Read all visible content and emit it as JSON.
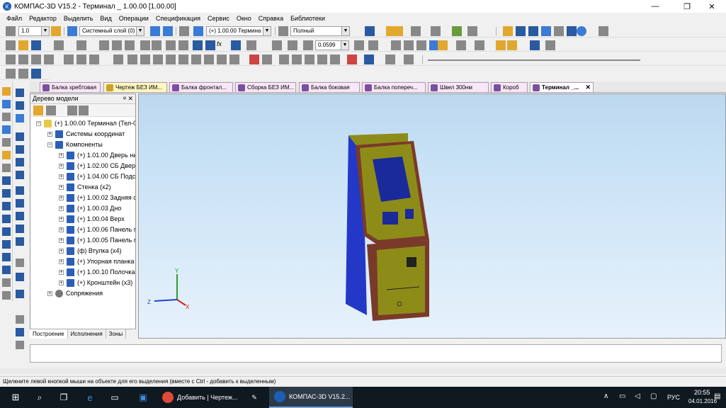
{
  "window": {
    "title": "КОМПАС-3D V15.2 - Терминал _ 1.00.00 [1.00.00]",
    "minimize": "—",
    "maximize": "❐",
    "close": "✕"
  },
  "menu": [
    "Файл",
    "Редактор",
    "Выделить",
    "Вид",
    "Операции",
    "Спецификация",
    "Сервис",
    "Окно",
    "Справка",
    "Библиотеки"
  ],
  "toolbar": {
    "step_value": "1.0",
    "layer_value": "Системный слой (0)",
    "component_value": "(+) 1.00.00 Термина",
    "render_mode": "Полный",
    "scale_value": "0.0599",
    "fx_label": "fx"
  },
  "tabs": [
    {
      "label": "Балка хребтовая",
      "active": false
    },
    {
      "label": "Чертеж БЕЗ ИМ...",
      "active": false
    },
    {
      "label": "Балка фронтал...",
      "active": false
    },
    {
      "label": "Сборка БЕЗ ИМ...",
      "active": false
    },
    {
      "label": "Балка боковая",
      "active": false
    },
    {
      "label": "Балка попереч...",
      "active": false
    },
    {
      "label": "Швел 300нм",
      "active": false
    },
    {
      "label": "Короб",
      "active": false
    },
    {
      "label": "Терминал _...",
      "active": true
    }
  ],
  "tree": {
    "title": "Дерево модели",
    "pin": "ᵠ",
    "close": "✕",
    "nodes": [
      {
        "label": "(+) 1.00.00 Терминал (Тел-0, 0",
        "level": 0,
        "expander": "⊟",
        "icon": "y"
      },
      {
        "label": "Системы координат",
        "level": 1,
        "expander": "⊞",
        "icon": "b"
      },
      {
        "label": "Компоненты",
        "level": 1,
        "expander": "⊟",
        "icon": "b"
      },
      {
        "label": "(+) 1.01.00 Дверь ниж",
        "level": 2,
        "expander": "⊞",
        "icon": "b"
      },
      {
        "label": "(+) 1.02.00 СБ Дверь в",
        "level": 2,
        "expander": "⊞",
        "icon": "b"
      },
      {
        "label": "(+) 1.04.00 СБ Подста",
        "level": 2,
        "expander": "⊞",
        "icon": "b"
      },
      {
        "label": "Стенка (x2)",
        "level": 2,
        "expander": "⊞",
        "icon": "b"
      },
      {
        "label": "(+) 1.00.02 Задняя сте",
        "level": 2,
        "expander": "⊞",
        "icon": "b"
      },
      {
        "label": "(+) 1.00.03 Дно",
        "level": 2,
        "expander": "⊞",
        "icon": "b"
      },
      {
        "label": "(+) 1.00.04 Верх",
        "level": 2,
        "expander": "⊞",
        "icon": "b"
      },
      {
        "label": "(+) 1.00.06 Панель пе",
        "level": 2,
        "expander": "⊞",
        "icon": "b"
      },
      {
        "label": "(+) 1.00.05 Панель пе",
        "level": 2,
        "expander": "⊞",
        "icon": "b"
      },
      {
        "label": "(ф) Втулка (x4)",
        "level": 2,
        "expander": "⊞",
        "icon": "b"
      },
      {
        "label": "(+) Упорная планка (",
        "level": 2,
        "expander": "⊞",
        "icon": "b"
      },
      {
        "label": "(+) 1.00.10 Полочка",
        "level": 2,
        "expander": "⊞",
        "icon": "b"
      },
      {
        "label": "(+) Кронштейн (x3)",
        "level": 2,
        "expander": "⊞",
        "icon": "b"
      },
      {
        "label": "Сопряжения",
        "level": 1,
        "expander": "⊞",
        "icon": "p"
      }
    ],
    "tabs": [
      "Построение",
      "Исполнения",
      "Зоны"
    ]
  },
  "axes": {
    "x": "X",
    "y": "Y",
    "z": "Z"
  },
  "status": "Щелкните левой кнопкой мыши на объекте для его выделения (вместе с Ctrl - добавить к выделенным)",
  "taskbar": {
    "task_chrome": "Добавить | Чертеж...",
    "task_kompas": "КОМПАС-3D V15.2...",
    "lang": "РУС",
    "time": "20:55",
    "date": "04.01.2016",
    "tray_chevron": "∧"
  },
  "colors": {
    "body_blue": "#2438c8",
    "panel_olive": "#8e8c18",
    "trim_brown": "#7a3a2a",
    "screen_blue": "#1a2a9a",
    "taskbar": "#101820"
  }
}
